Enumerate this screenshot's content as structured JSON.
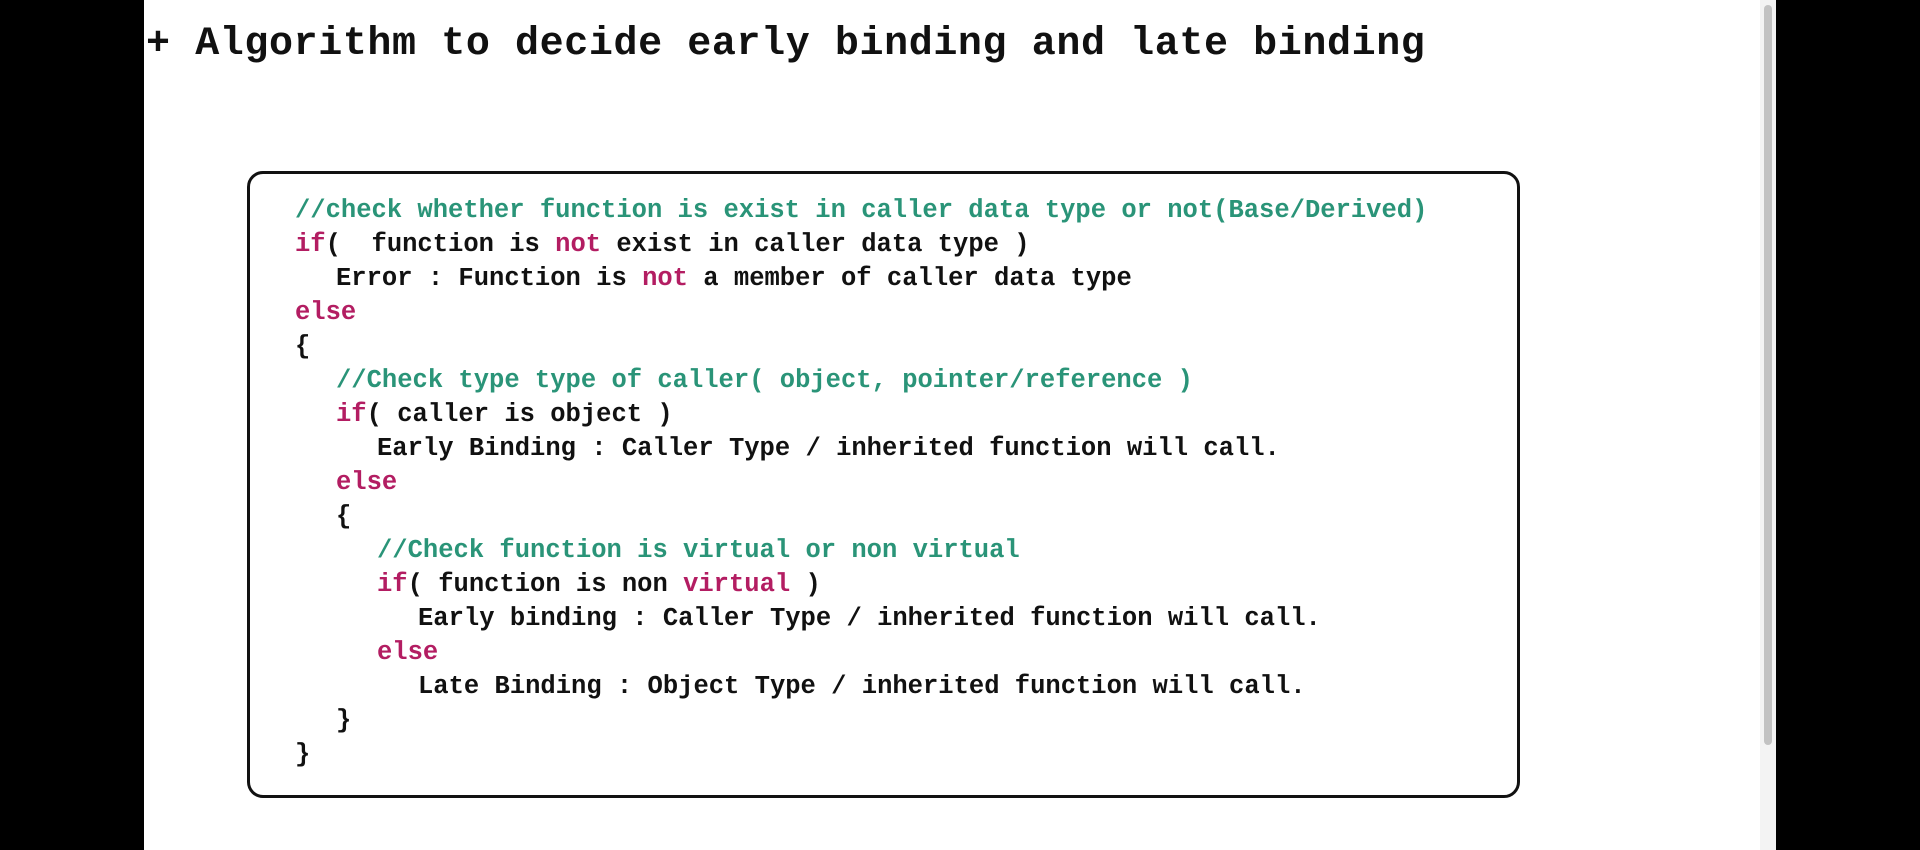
{
  "heading": "+ Algorithm to decide early binding and late binding",
  "code_lines": [
    {
      "indent": 1,
      "tokens": [
        {
          "t": "comment",
          "text": "//check whether function is exist in caller data type or not(Base/Derived)"
        }
      ]
    },
    {
      "indent": 1,
      "tokens": [
        {
          "t": "keyword",
          "text": "if"
        },
        {
          "t": "plain",
          "text": "(  function is "
        },
        {
          "t": "keyword",
          "text": "not"
        },
        {
          "t": "plain",
          "text": " exist in caller data type )"
        }
      ]
    },
    {
      "indent": 2,
      "tokens": [
        {
          "t": "plain",
          "text": "Error : Function is "
        },
        {
          "t": "keyword",
          "text": "not"
        },
        {
          "t": "plain",
          "text": " a member of caller data type"
        }
      ]
    },
    {
      "indent": 1,
      "tokens": [
        {
          "t": "keyword",
          "text": "else"
        }
      ]
    },
    {
      "indent": 1,
      "tokens": [
        {
          "t": "plain",
          "text": "{"
        }
      ]
    },
    {
      "indent": 2,
      "tokens": [
        {
          "t": "comment",
          "text": "//Check type type of caller( object, pointer/reference )"
        }
      ]
    },
    {
      "indent": 2,
      "tokens": [
        {
          "t": "keyword",
          "text": "if"
        },
        {
          "t": "plain",
          "text": "( caller is object )"
        }
      ]
    },
    {
      "indent": 3,
      "tokens": [
        {
          "t": "plain",
          "text": "Early Binding : Caller Type / inherited function will call."
        }
      ]
    },
    {
      "indent": 2,
      "tokens": [
        {
          "t": "keyword",
          "text": "else"
        }
      ]
    },
    {
      "indent": 2,
      "tokens": [
        {
          "t": "plain",
          "text": "{"
        }
      ]
    },
    {
      "indent": 3,
      "tokens": [
        {
          "t": "comment",
          "text": "//Check function is virtual or non virtual"
        }
      ]
    },
    {
      "indent": 3,
      "tokens": [
        {
          "t": "keyword",
          "text": "if"
        },
        {
          "t": "plain",
          "text": "( function is non "
        },
        {
          "t": "keyword",
          "text": "virtual"
        },
        {
          "t": "plain",
          "text": " )"
        }
      ]
    },
    {
      "indent": 4,
      "tokens": [
        {
          "t": "plain",
          "text": "Early binding : Caller Type / inherited function will call."
        }
      ]
    },
    {
      "indent": 3,
      "tokens": [
        {
          "t": "keyword",
          "text": "else"
        }
      ]
    },
    {
      "indent": 4,
      "tokens": [
        {
          "t": "plain",
          "text": "Late Binding : Object Type / inherited function will call."
        }
      ]
    },
    {
      "indent": 2,
      "tokens": [
        {
          "t": "plain",
          "text": "}"
        }
      ]
    },
    {
      "indent": 1,
      "tokens": [
        {
          "t": "plain",
          "text": "}"
        }
      ]
    }
  ],
  "colors": {
    "comment": "#2a9478",
    "keyword": "#b31d62",
    "text": "#111111",
    "background": "#ffffff",
    "letterbox": "#000000"
  }
}
